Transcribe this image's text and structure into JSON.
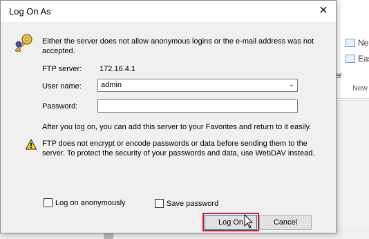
{
  "dialog": {
    "title": "Log On As",
    "message": "Either the server does not allow anonymous logins or the e-mail address was not accepted.",
    "ftp_server_label": "FTP server:",
    "ftp_server_value": "172.16.4.1",
    "username_label": "User name:",
    "username_value": "admin",
    "password_label": "Password:",
    "password_value": "",
    "info_text": "After you log on, you can add this server to your Favorites and return to it easily.",
    "warning_text": "FTP does not encrypt or encode passwords or data before sending them to the server.  To protect the security of your passwords and data, use WebDAV instead.",
    "anonymous_label": "Log on anonymously",
    "anonymous_checked": false,
    "save_password_label": "Save password",
    "save_password_checked": false,
    "logon_label": "Log On",
    "cancel_label": "Cancel",
    "icons": {
      "close": "close-icon",
      "key": "key-icon",
      "warning": "warning-icon",
      "dropdown": "chevron-down-icon"
    }
  },
  "background": {
    "ribbon_items": [
      "Ne",
      "Eas"
    ],
    "ribbon_partial": "er",
    "group_label": "New"
  }
}
